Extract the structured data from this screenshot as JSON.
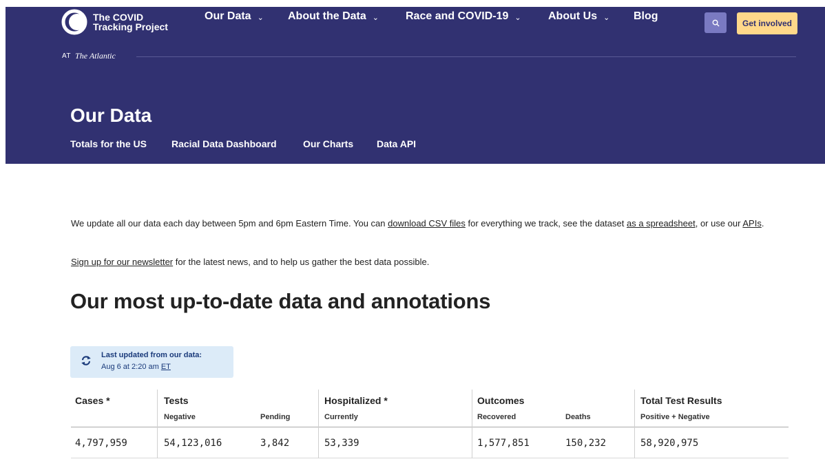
{
  "brand": {
    "line1": "The COVID",
    "line2": "Tracking Project",
    "at": "AT",
    "publisher": "The Atlantic"
  },
  "nav": {
    "items": [
      {
        "label": "Our Data",
        "has_dropdown": true
      },
      {
        "label": "About the Data",
        "has_dropdown": true
      },
      {
        "label": "Race and COVID-19",
        "has_dropdown": true
      },
      {
        "label": "About Us",
        "has_dropdown": true
      },
      {
        "label": "Blog",
        "has_dropdown": false
      }
    ],
    "search_icon": "search-icon",
    "cta_label": "Get involved"
  },
  "page": {
    "title": "Our Data",
    "subnav": [
      "Totals for the US",
      "Racial Data Dashboard",
      "Our Charts",
      "Data API"
    ]
  },
  "intro": {
    "text1": "We update all our data each day between 5pm and 6pm Eastern Time. You can ",
    "link1": "download CSV files",
    "text2": " for everything we track, see the dataset ",
    "link2": "as a spreadsheet",
    "text3": ", or use our ",
    "link3": "APIs",
    "text4": "."
  },
  "newsletter": {
    "link": "Sign up for our newsletter",
    "text": " for the latest news, and to help us gather the best data possible."
  },
  "section_heading": "Our most up-to-date data and annotations",
  "last_updated": {
    "label": "Last updated from our data:",
    "date": "Aug 6 at 2:20 am",
    "tz": "ET"
  },
  "table": {
    "headers": [
      "Cases *",
      "Tests",
      "Hospitalized *",
      "Outcomes",
      "Total Test Results"
    ],
    "subheaders": [
      "Negative",
      "Pending",
      "Currently",
      "Recovered",
      "Deaths",
      "Positive + Negative"
    ],
    "values": [
      "4,797,959",
      "54,123,016",
      "3,842",
      "53,339",
      "1,577,851",
      "150,232",
      "58,920,975"
    ]
  },
  "colors": {
    "header_bg": "#313171",
    "cta_bg": "#ffd88a",
    "search_bg": "#7a7ac2",
    "updated_bg": "#dcebf8"
  }
}
